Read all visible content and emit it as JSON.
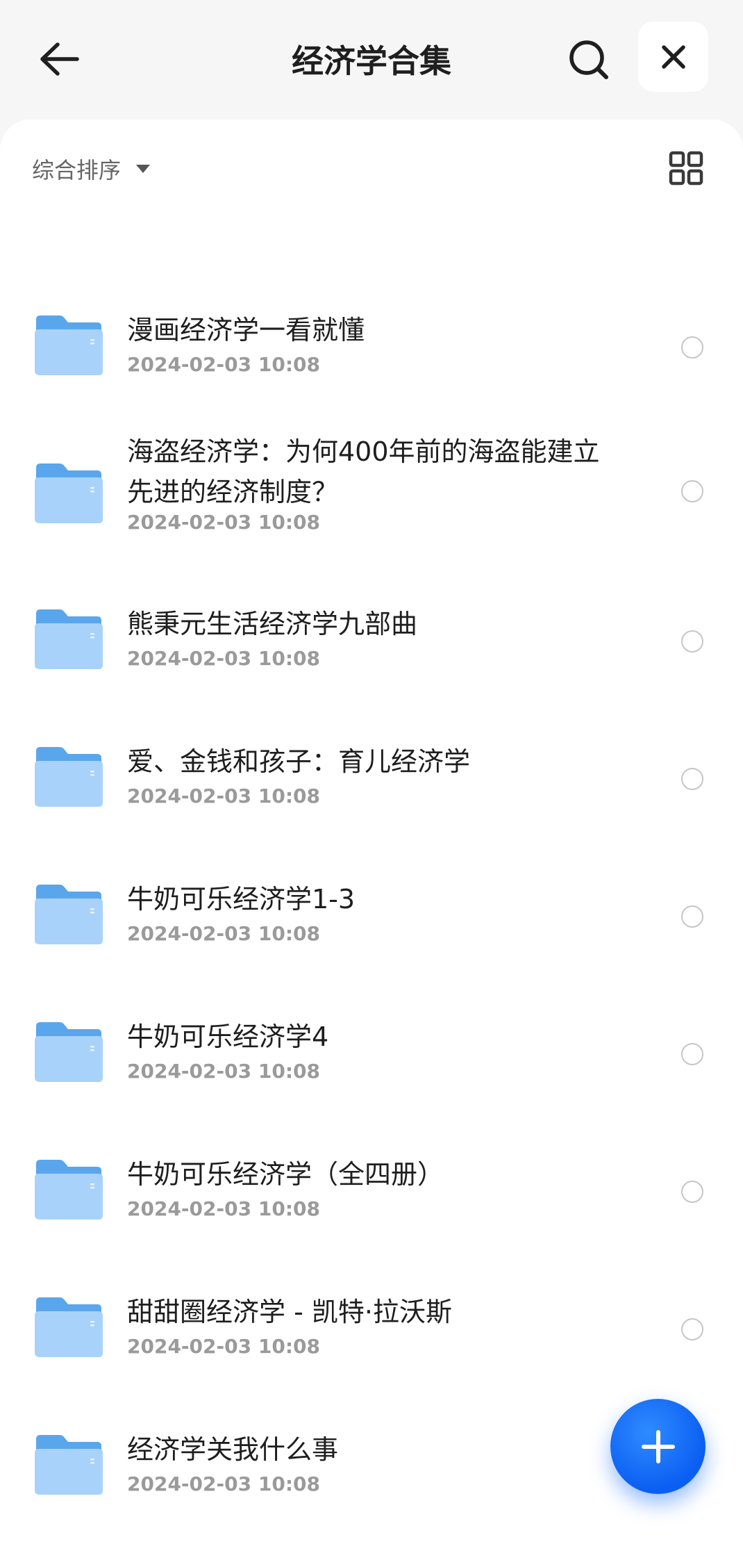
{
  "header": {
    "title": "经济学合集"
  },
  "toolbar": {
    "sort_label": "综合排序"
  },
  "colors": {
    "accent": "#1a6dff",
    "folder_back": "#5aa6ec",
    "folder_front": "#a9d2fa"
  },
  "icons": {
    "back": "arrow-left-icon",
    "search": "search-icon",
    "close": "close-icon",
    "sort": "caret-down-icon",
    "view": "grid-view-icon",
    "folder": "folder-icon",
    "select": "radio-circle-icon",
    "add": "plus-icon"
  },
  "items": [
    {
      "title": "",
      "date": "2024-02-03 10:08"
    },
    {
      "title": "漫画经济学一看就懂",
      "date": "2024-02-03 10:08"
    },
    {
      "title": "海盗经济学：为何400年前的海盗能建立先进的经济制度？",
      "date": "2024-02-03 10:08"
    },
    {
      "title": "熊秉元生活经济学九部曲",
      "date": "2024-02-03 10:08"
    },
    {
      "title": "爱、金钱和孩子：育儿经济学",
      "date": "2024-02-03 10:08"
    },
    {
      "title": "牛奶可乐经济学1-3",
      "date": "2024-02-03 10:08"
    },
    {
      "title": "牛奶可乐经济学4",
      "date": "2024-02-03 10:08"
    },
    {
      "title": "牛奶可乐经济学（全四册）",
      "date": "2024-02-03 10:08"
    },
    {
      "title": "甜甜圈经济学 - 凯特·拉沃斯",
      "date": "2024-02-03 10:08"
    },
    {
      "title": "经济学关我什么事",
      "date": "2024-02-03 10:08"
    }
  ]
}
